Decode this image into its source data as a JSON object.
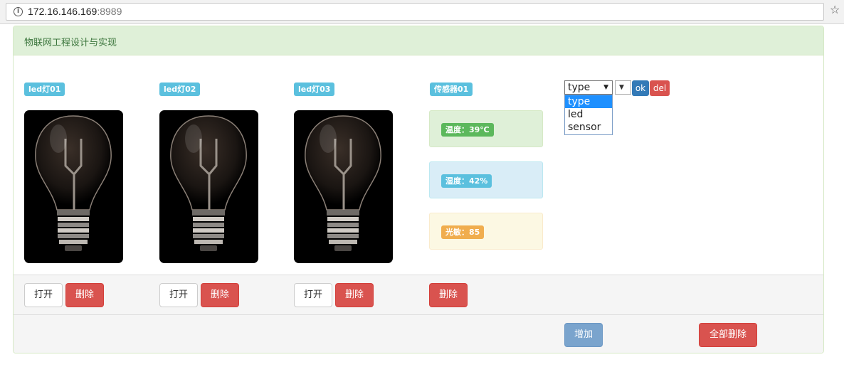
{
  "browser": {
    "url_host": "172.16.146.169",
    "url_port": ":8989"
  },
  "panel": {
    "title": "物联网工程设计与实现"
  },
  "devices": [
    {
      "label": "led灯01",
      "open_label": "打开",
      "delete_label": "删除"
    },
    {
      "label": "led灯02",
      "open_label": "打开",
      "delete_label": "删除"
    },
    {
      "label": "led灯03",
      "open_label": "打开",
      "delete_label": "删除"
    }
  ],
  "sensor": {
    "label": "传感器01",
    "temperature": "温度：39℃",
    "humidity": "湿度：42%",
    "light": "光敏：85",
    "delete_label": "删除"
  },
  "controls": {
    "type_select_value": "type",
    "type_options": [
      "type",
      "led",
      "sensor"
    ],
    "ok_label": "ok",
    "del_label": "del"
  },
  "footer": {
    "add_label": "增加",
    "delete_all_label": "全部删除"
  },
  "colors": {
    "heading_bg": "#dff0d8",
    "label_info": "#5bc0de",
    "danger": "#d9534f",
    "primary": "#337ab7"
  }
}
